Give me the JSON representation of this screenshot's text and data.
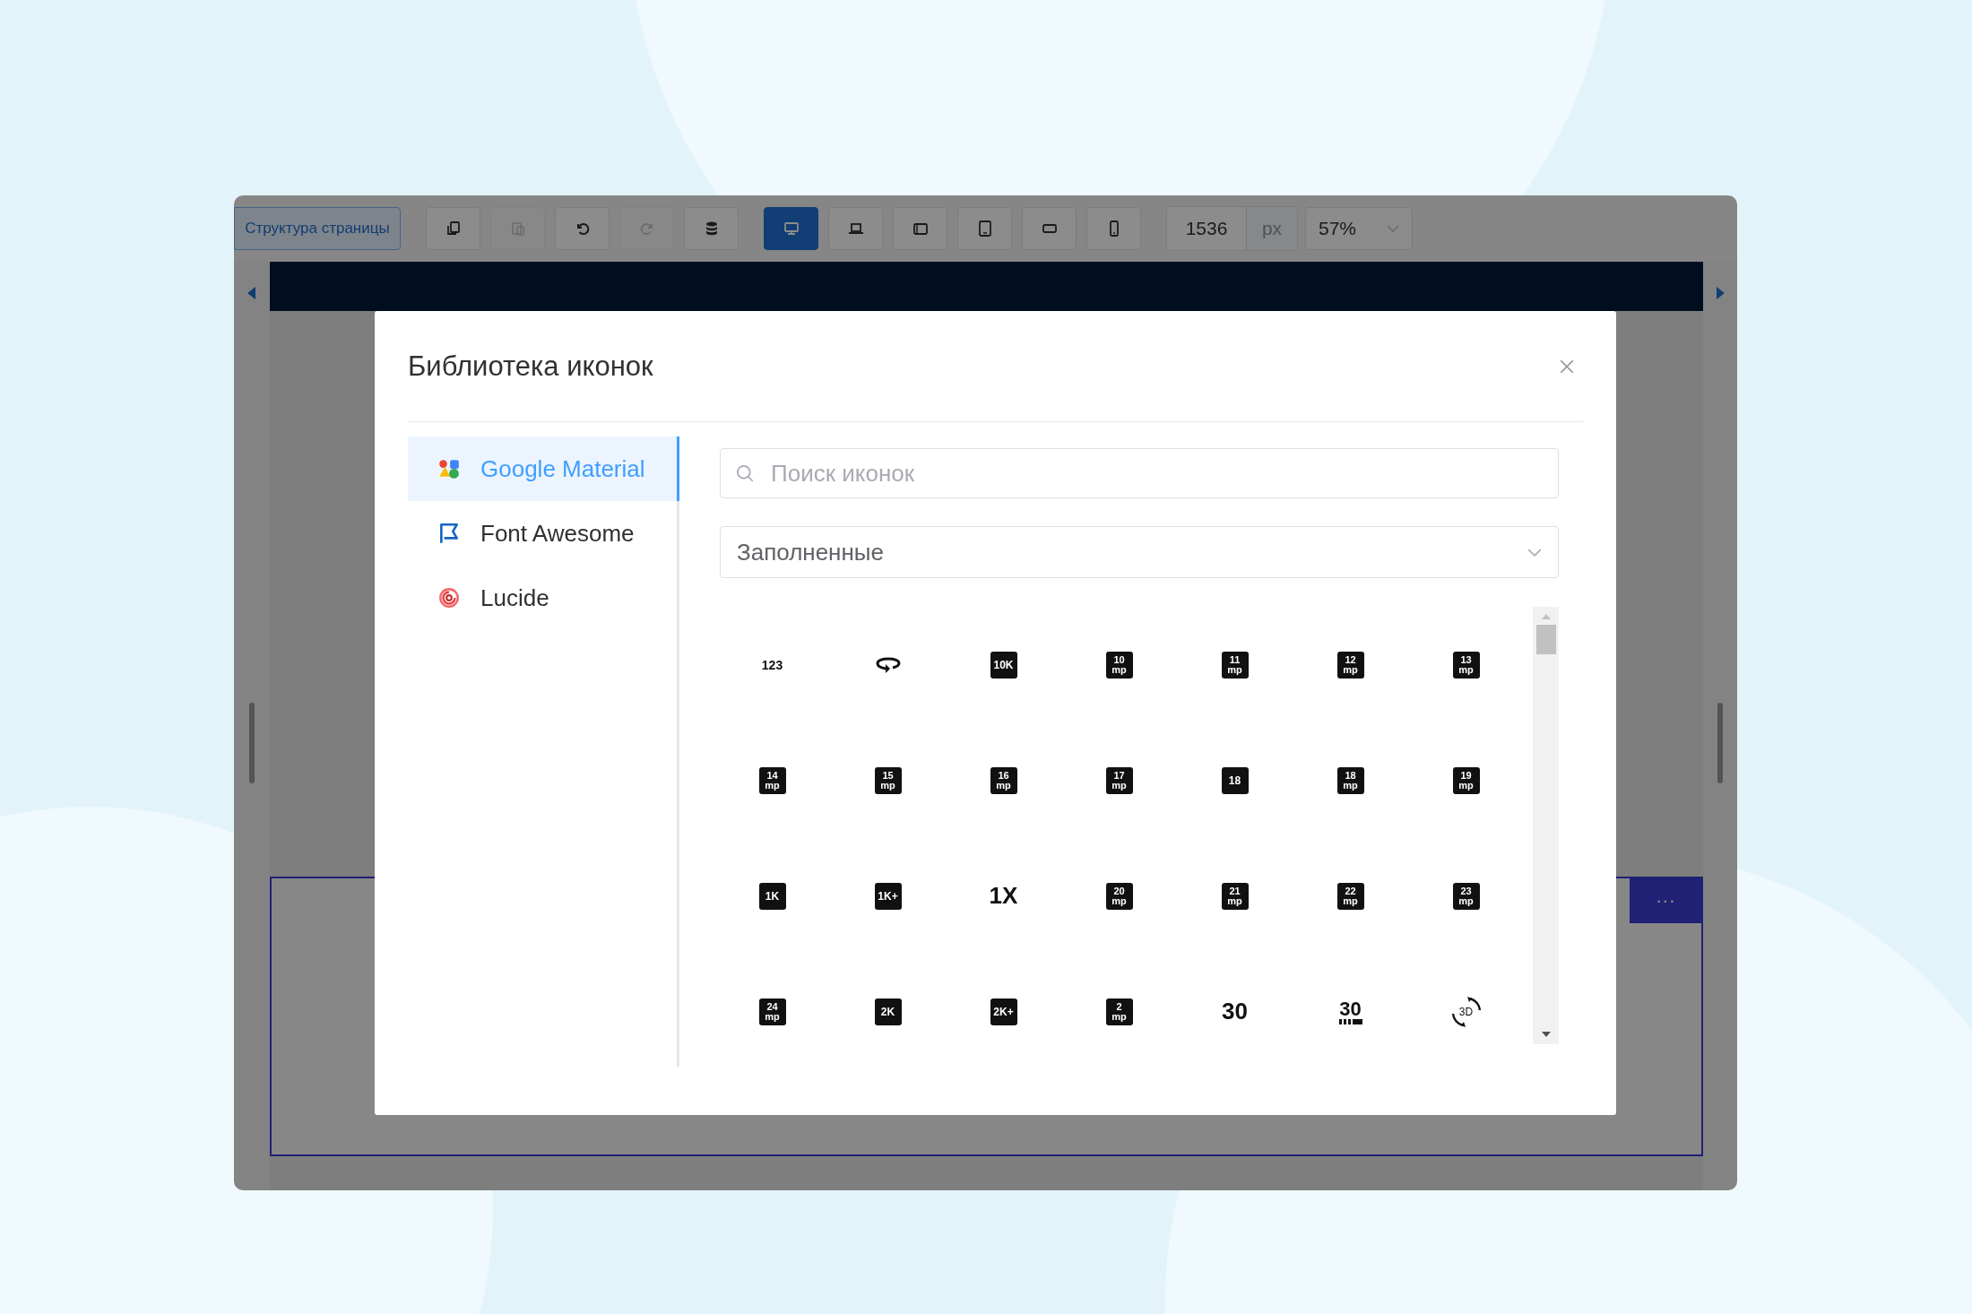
{
  "toolbar": {
    "structure_button": "Структура страницы",
    "edit_buttons": [
      {
        "kind": "copy",
        "disabled": false
      },
      {
        "kind": "paste",
        "disabled": true
      },
      {
        "kind": "undo",
        "disabled": false
      },
      {
        "kind": "redo",
        "disabled": true
      },
      {
        "kind": "database",
        "disabled": false
      }
    ],
    "devices": [
      {
        "kind": "desktop",
        "selected": true
      },
      {
        "kind": "laptop",
        "selected": false
      },
      {
        "kind": "tablet-landscape",
        "selected": false
      },
      {
        "kind": "tablet",
        "selected": false
      },
      {
        "kind": "phone-landscape",
        "selected": false
      },
      {
        "kind": "phone",
        "selected": false
      }
    ],
    "width_value": "1536",
    "width_unit": "px",
    "zoom": "57%"
  },
  "frame_menu": "···",
  "modal": {
    "title": "Библиотека иконок",
    "sidebar": {
      "items": [
        {
          "label": "Google Material",
          "kind": "material",
          "selected": true
        },
        {
          "label": "Font Awesome",
          "kind": "flag",
          "selected": false
        },
        {
          "label": "Lucide",
          "kind": "spiral",
          "selected": false
        }
      ]
    },
    "search": {
      "placeholder": "Поиск иконок"
    },
    "style_select": {
      "value": "Заполненные"
    },
    "icons": [
      {
        "kind": "plain",
        "label": "123"
      },
      {
        "kind": "rotate"
      },
      {
        "kind": "box",
        "label": "10K"
      },
      {
        "kind": "mp",
        "label": "10",
        "sub": "mp"
      },
      {
        "kind": "mp",
        "label": "11",
        "sub": "mp"
      },
      {
        "kind": "mp",
        "label": "12",
        "sub": "mp"
      },
      {
        "kind": "mp",
        "label": "13",
        "sub": "mp"
      },
      {
        "kind": "mp",
        "label": "14",
        "sub": "mp"
      },
      {
        "kind": "mp",
        "label": "15",
        "sub": "mp"
      },
      {
        "kind": "mp",
        "label": "16",
        "sub": "mp"
      },
      {
        "kind": "mp",
        "label": "17",
        "sub": "mp"
      },
      {
        "kind": "box",
        "label": "18"
      },
      {
        "kind": "mp",
        "label": "18",
        "sub": "mp"
      },
      {
        "kind": "mp",
        "label": "19",
        "sub": "mp"
      },
      {
        "kind": "box",
        "label": "1K"
      },
      {
        "kind": "box",
        "label": "1K+"
      },
      {
        "kind": "large",
        "label": "1X"
      },
      {
        "kind": "mp",
        "label": "20",
        "sub": "mp"
      },
      {
        "kind": "mp",
        "label": "21",
        "sub": "mp"
      },
      {
        "kind": "mp",
        "label": "22",
        "sub": "mp"
      },
      {
        "kind": "mp",
        "label": "23",
        "sub": "mp"
      },
      {
        "kind": "mp",
        "label": "24",
        "sub": "mp"
      },
      {
        "kind": "box",
        "label": "2K"
      },
      {
        "kind": "box",
        "label": "2K+"
      },
      {
        "kind": "mp",
        "label": "2",
        "sub": "mp"
      },
      {
        "kind": "large",
        "label": "30"
      },
      {
        "kind": "fps",
        "label": "30"
      },
      {
        "kind": "rotate3d",
        "label": "3D"
      }
    ]
  }
}
